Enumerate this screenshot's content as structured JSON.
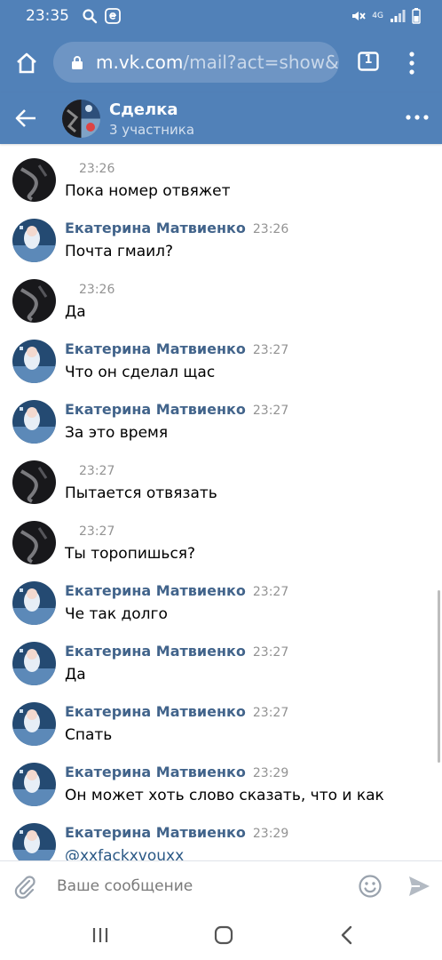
{
  "status_bar": {
    "time": "23:35",
    "network_label": "4G",
    "icons": [
      "search-icon",
      "e-icon",
      "mute-icon",
      "signal-icon",
      "battery-icon"
    ]
  },
  "browser": {
    "url_host": "m.vk.com",
    "url_path": "/mail?act=show&",
    "tab_count": "1",
    "icons": [
      "home-icon",
      "lock-icon",
      "tabs-icon",
      "menu-icon"
    ]
  },
  "chat": {
    "title": "Сделка",
    "subtitle": "3 участника"
  },
  "messages": [
    {
      "name": "",
      "time": "23:26",
      "text": "Пока номер отвяжет",
      "avatar": "dark"
    },
    {
      "name": "Екатерина Матвиенко",
      "time": "23:26",
      "text": "Почта гмаил?",
      "avatar": "blue"
    },
    {
      "name": "",
      "time": "23:26",
      "text": "Да",
      "avatar": "dark"
    },
    {
      "name": "Екатерина Матвиенко",
      "time": "23:27",
      "text": "Что он сделал щас",
      "avatar": "blue"
    },
    {
      "name": "Екатерина Матвиенко",
      "time": "23:27",
      "text": "За это время",
      "avatar": "blue"
    },
    {
      "name": "",
      "time": "23:27",
      "text": "Пытается отвязать",
      "avatar": "dark"
    },
    {
      "name": "",
      "time": "23:27",
      "text": "Ты торопишься?",
      "avatar": "dark"
    },
    {
      "name": "Екатерина Матвиенко",
      "time": "23:27",
      "text": "Че так долго",
      "avatar": "blue"
    },
    {
      "name": "Екатерина Матвиенко",
      "time": "23:27",
      "text": "Да",
      "avatar": "blue"
    },
    {
      "name": "Екатерина Матвиенко",
      "time": "23:27",
      "text": "Спать",
      "avatar": "blue"
    },
    {
      "name": "Екатерина Матвиенко",
      "time": "23:29",
      "text": "Он может хоть слово сказать, что и как",
      "avatar": "blue"
    },
    {
      "name": "Екатерина Матвиенко",
      "time": "23:29",
      "text": "@xxfackxvouxx",
      "avatar": "blue",
      "is_link": true
    }
  ],
  "composer": {
    "placeholder": "Ваше сообщение",
    "value": ""
  },
  "colors": {
    "header_bg": "#5181b8",
    "name_color": "#42648b",
    "link_color": "#2a5885",
    "time_color": "#939393"
  }
}
